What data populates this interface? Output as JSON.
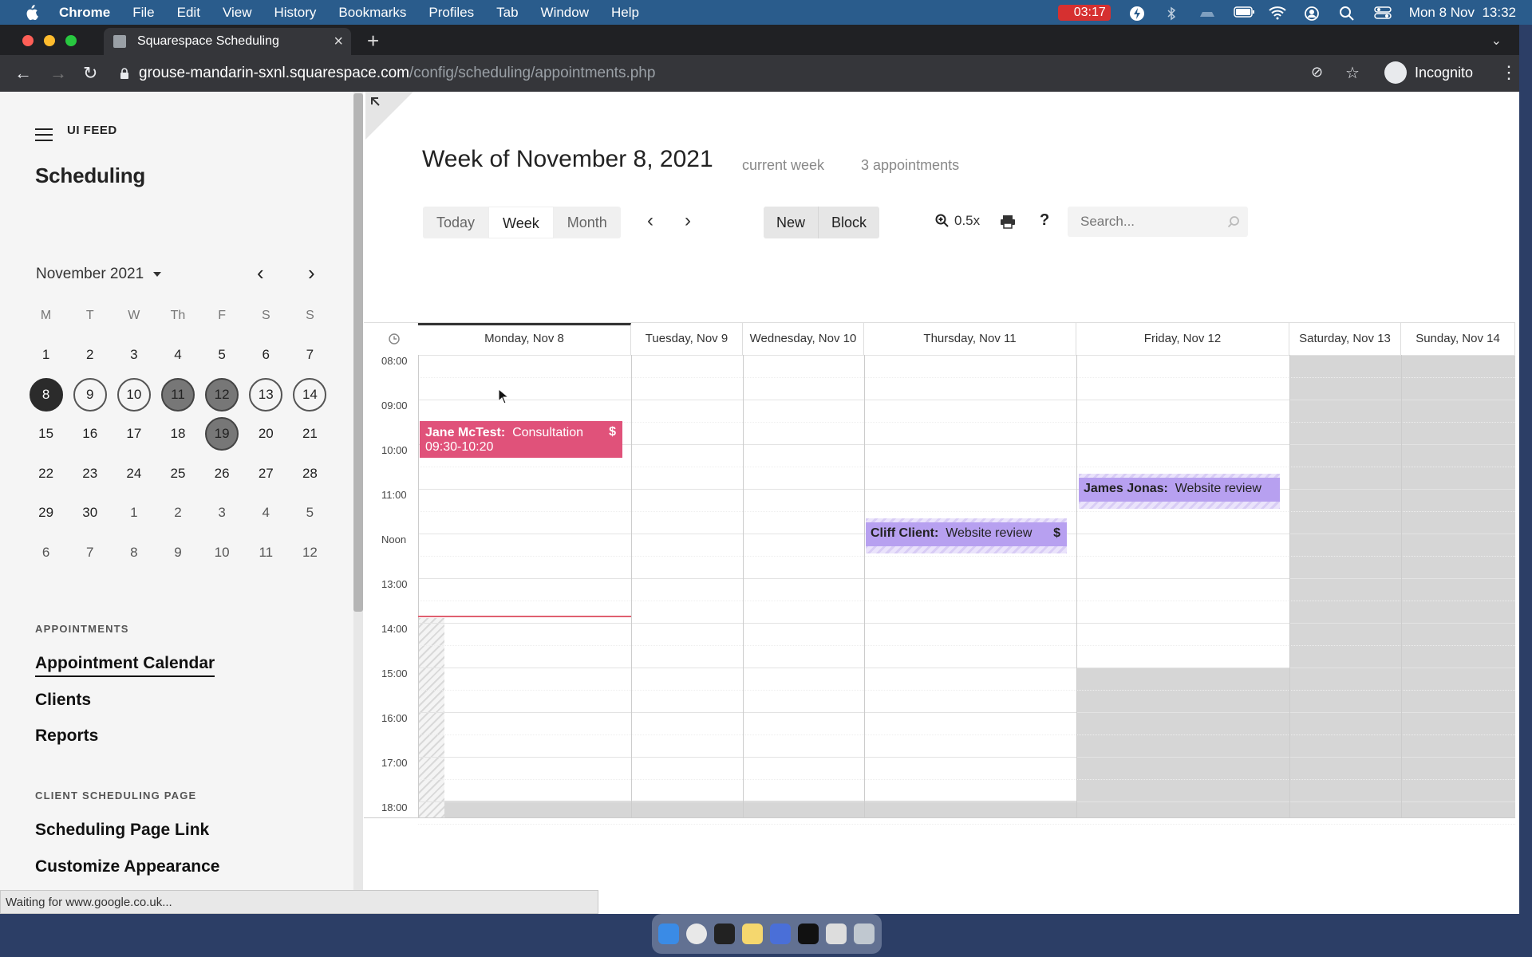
{
  "menubar": {
    "app": "Chrome",
    "items": [
      "File",
      "Edit",
      "View",
      "History",
      "Bookmarks",
      "Profiles",
      "Tab",
      "Window",
      "Help"
    ],
    "battery_time": "03:17",
    "datetime": "Mon 8 Nov  13:32"
  },
  "browser": {
    "tab_title": "Squarespace Scheduling",
    "url_host": "grouse-mandarin-sxnl.squarespace.com",
    "url_path": "/config/scheduling/appointments.php",
    "profile": "Incognito",
    "status": "Waiting for www.google.co.uk..."
  },
  "sidebar": {
    "site": "UI FEED",
    "title": "Scheduling",
    "month": "November 2021",
    "weekday_headers": [
      "M",
      "T",
      "W",
      "Th",
      "F",
      "S",
      "S"
    ],
    "weeks": [
      [
        "1",
        "2",
        "3",
        "4",
        "5",
        "6",
        "7"
      ],
      [
        "8",
        "9",
        "10",
        "11",
        "12",
        "13",
        "14"
      ],
      [
        "15",
        "16",
        "17",
        "18",
        "19",
        "20",
        "21"
      ],
      [
        "22",
        "23",
        "24",
        "25",
        "26",
        "27",
        "28"
      ],
      [
        "29",
        "30",
        "1",
        "2",
        "3",
        "4",
        "5"
      ],
      [
        "6",
        "7",
        "8",
        "9",
        "10",
        "11",
        "12"
      ]
    ],
    "appointments_label": "APPOINTMENTS",
    "links": [
      "Appointment Calendar",
      "Clients",
      "Reports"
    ],
    "client_label": "CLIENT SCHEDULING PAGE",
    "client_links": [
      "Scheduling Page Link",
      "Customize Appearance"
    ]
  },
  "main": {
    "title": "Week of November 8, 2021",
    "current_week": "current week",
    "appt_count": "3 appointments",
    "views": [
      "Today",
      "Week",
      "Month"
    ],
    "new_label": "New",
    "block_label": "Block",
    "zoom": "0.5x",
    "help": "?",
    "search_placeholder": "Search..."
  },
  "calendar": {
    "days": [
      "Monday, Nov 8",
      "Tuesday, Nov 9",
      "Wednesday, Nov 10",
      "Thursday, Nov 11",
      "Friday, Nov 12",
      "Saturday, Nov 13",
      "Sunday, Nov 14"
    ],
    "times": [
      "08:00",
      "09:00",
      "10:00",
      "11:00",
      "Noon",
      "13:00",
      "14:00",
      "15:00",
      "16:00",
      "17:00",
      "18:00"
    ],
    "appointments": [
      {
        "client": "Jane McTest:",
        "type": "Consultation",
        "time": "09:30-10:20",
        "paid_symbol": "$"
      },
      {
        "client": "Cliff Client:",
        "type": "Website review",
        "paid_symbol": "$"
      },
      {
        "client": "James Jonas:",
        "type": "Website review"
      }
    ]
  },
  "colors": {
    "accent_pink": "#e0527a",
    "accent_purple": "#b7a0f0",
    "menubar": "#2a5c8c"
  }
}
